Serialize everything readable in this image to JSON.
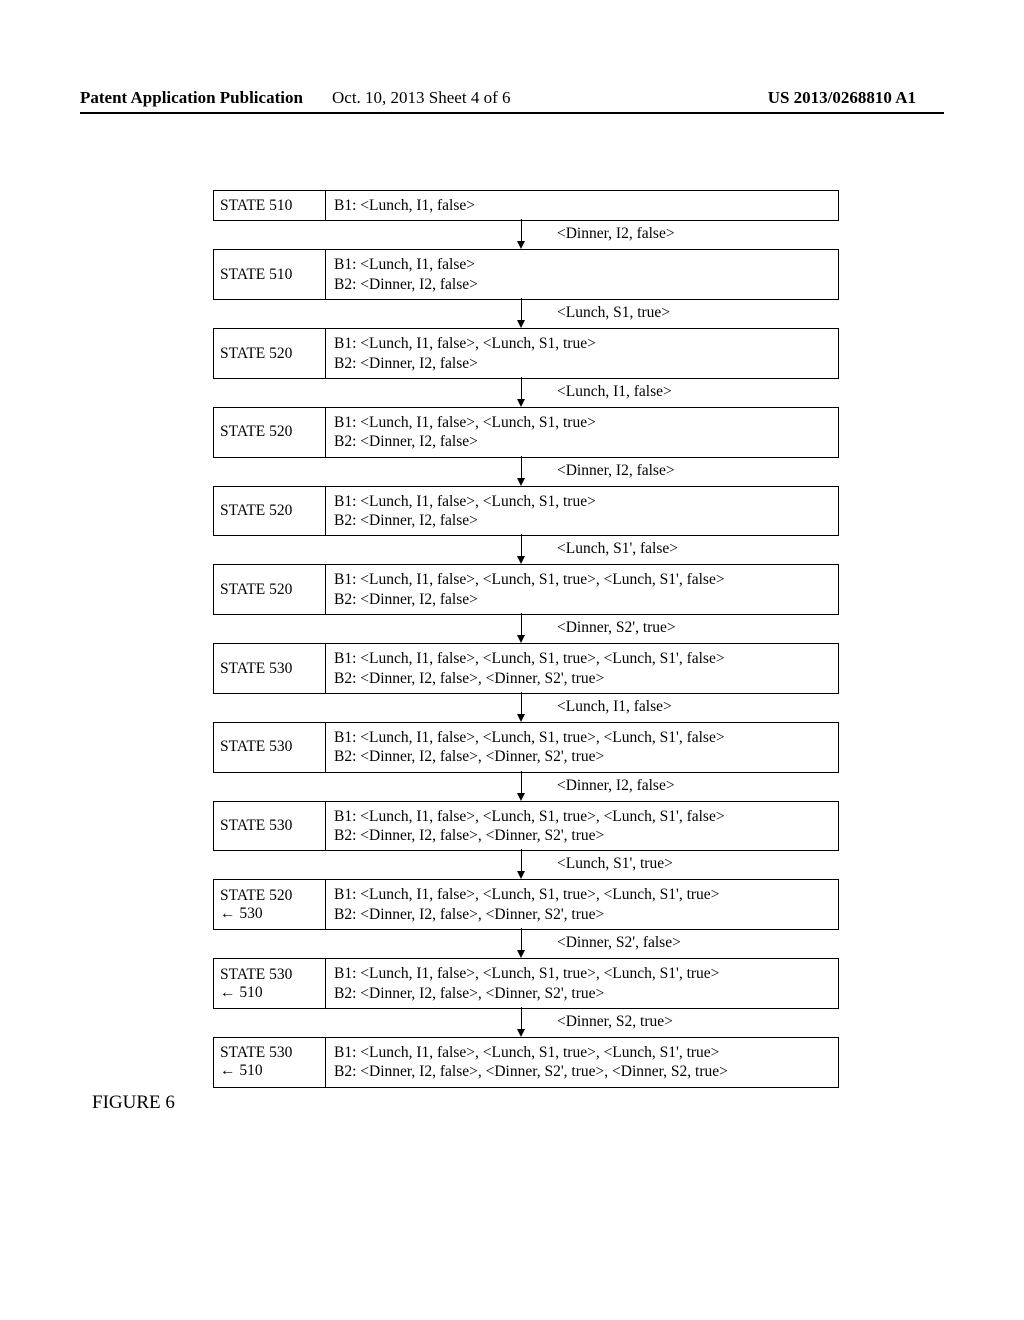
{
  "header": {
    "left": "Patent Application Publication",
    "mid": "Oct. 10, 2013  Sheet 4 of 6",
    "right": "US 2013/0268810 A1"
  },
  "states": [
    {
      "label": "STATE 510",
      "lines": [
        {
          "tag": "B1:",
          "text": "<Lunch, I1, false>"
        }
      ]
    },
    {
      "label": "STATE 510",
      "lines": [
        {
          "tag": "B1:",
          "text": "<Lunch, I1, false>"
        },
        {
          "tag": "B2:",
          "text": "<Dinner, I2, false>"
        }
      ]
    },
    {
      "label": "STATE 520",
      "lines": [
        {
          "tag": "B1:",
          "text": "<Lunch, I1, false>, <Lunch, S1, true>"
        },
        {
          "tag": "B2:",
          "text": "<Dinner, I2, false>"
        }
      ]
    },
    {
      "label": "STATE 520",
      "lines": [
        {
          "tag": "B1:",
          "text": "<Lunch, I1, false>, <Lunch, S1, true>"
        },
        {
          "tag": "B2:",
          "text": "<Dinner, I2, false>"
        }
      ]
    },
    {
      "label": "STATE 520",
      "lines": [
        {
          "tag": "B1:",
          "text": "<Lunch, I1, false>, <Lunch, S1, true>"
        },
        {
          "tag": "B2:",
          "text": "<Dinner, I2, false>"
        }
      ]
    },
    {
      "label": "STATE 520",
      "lines": [
        {
          "tag": "B1:",
          "text": "<Lunch, I1, false>, <Lunch, S1, true>, <Lunch, S1', false>"
        },
        {
          "tag": "B2:",
          "text": "<Dinner, I2, false>"
        }
      ]
    },
    {
      "label": "STATE 530",
      "lines": [
        {
          "tag": "B1:",
          "text": "<Lunch, I1, false>, <Lunch, S1, true>, <Lunch, S1', false>"
        },
        {
          "tag": "B2:",
          "text": "<Dinner, I2, false>, <Dinner, S2', true>"
        }
      ]
    },
    {
      "label": "STATE 530",
      "lines": [
        {
          "tag": "B1:",
          "text": "<Lunch, I1, false>, <Lunch, S1, true>, <Lunch, S1', false>"
        },
        {
          "tag": "B2:",
          "text": "<Dinner, I2, false>, <Dinner, S2', true>"
        }
      ]
    },
    {
      "label": "STATE 530",
      "lines": [
        {
          "tag": "B1:",
          "text": "<Lunch, I1, false>, <Lunch, S1, true>, <Lunch, S1', false>"
        },
        {
          "tag": "B2:",
          "text": "<Dinner, I2, false>, <Dinner, S2', true>"
        }
      ]
    },
    {
      "label": "STATE 520\n← 530",
      "lines": [
        {
          "tag": "B1:",
          "text": "<Lunch, I1, false>, <Lunch, S1, true>, <Lunch, S1', true>"
        },
        {
          "tag": "B2:",
          "text": "<Dinner, I2, false>, <Dinner, S2', true>"
        }
      ]
    },
    {
      "label": "STATE 530\n← 510",
      "lines": [
        {
          "tag": "B1:",
          "text": "<Lunch, I1, false>, <Lunch, S1, true>, <Lunch, S1', true>"
        },
        {
          "tag": "B2:",
          "text": "<Dinner, I2, false>, <Dinner, S2', true>"
        }
      ]
    },
    {
      "label": "STATE 530\n← 510",
      "lines": [
        {
          "tag": "B1:",
          "text": "<Lunch, I1, false>, <Lunch, S1, true>, <Lunch, S1', true>"
        },
        {
          "tag": "B2:",
          "text": "<Dinner, I2, false>, <Dinner, S2', true>, <Dinner, S2, true>"
        }
      ]
    }
  ],
  "transitions": [
    "<Dinner, I2, false>",
    "<Lunch, S1, true>",
    "<Lunch, I1, false>",
    "<Dinner, I2, false>",
    "<Lunch, S1', false>",
    "<Dinner, S2', true>",
    "<Lunch, I1, false>",
    "<Dinner, I2, false>",
    "<Lunch, S1', true>",
    "<Dinner, S2', false>",
    "<Dinner, S2, true>"
  ],
  "figure_caption": "FIGURE 6"
}
